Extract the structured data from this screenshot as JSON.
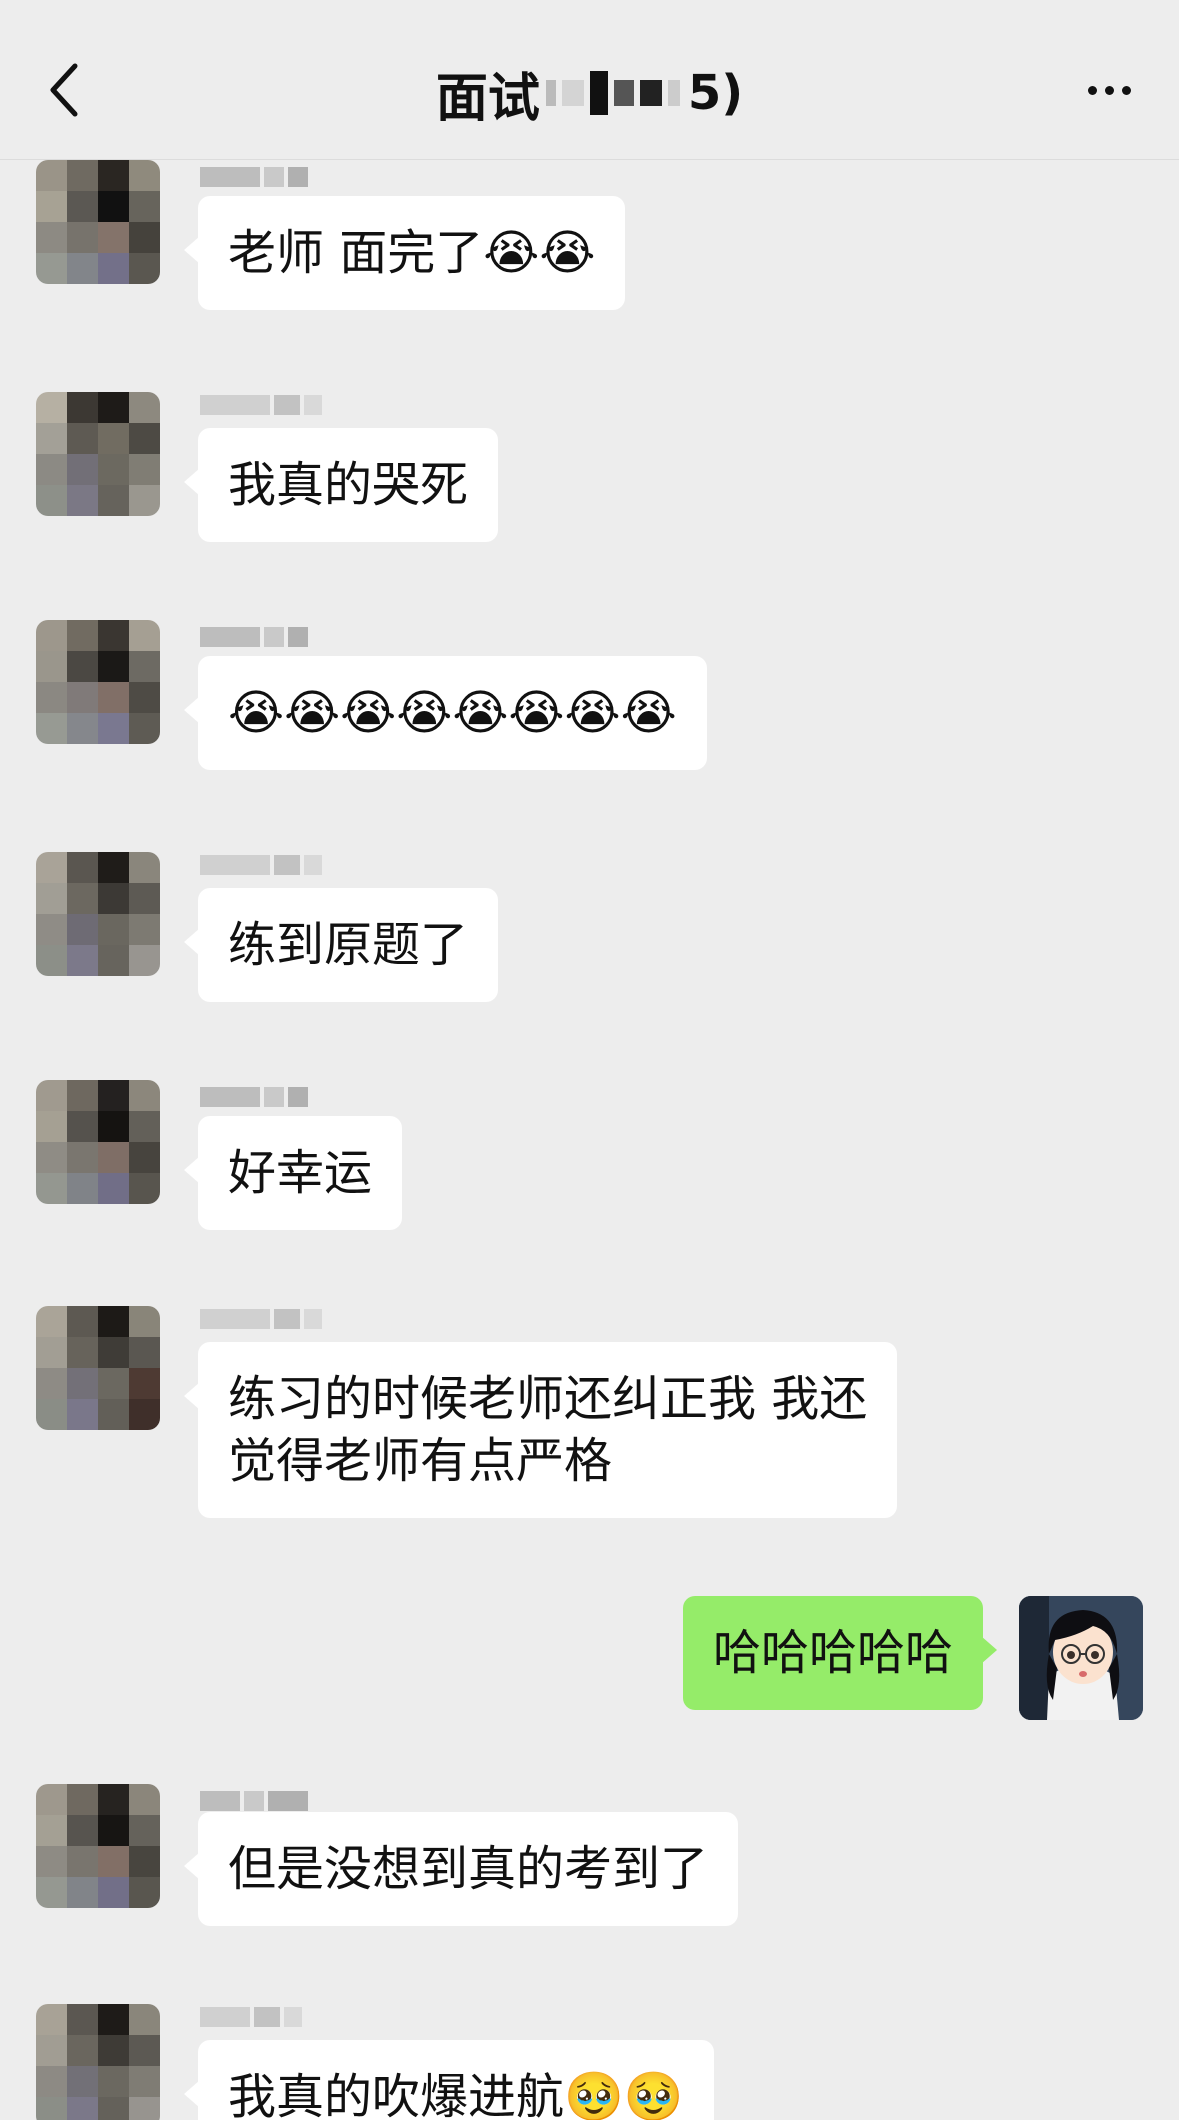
{
  "header": {
    "back_icon": "chevron-left-icon",
    "title": "面试",
    "title_suffix": "5)",
    "more_icon": "more-dots-icon"
  },
  "messages": [
    {
      "side": "left",
      "text": "老师 面完了😭😭"
    },
    {
      "side": "left",
      "text": "我真的哭死"
    },
    {
      "side": "left",
      "text": "😭😭😭😭😭😭😭😭"
    },
    {
      "side": "left",
      "text": "练到原题了"
    },
    {
      "side": "left",
      "text": "好幸运"
    },
    {
      "side": "left",
      "text": "练习的时候老师还纠正我 我还\n觉得老师有点严格"
    },
    {
      "side": "right",
      "text": "哈哈哈哈哈"
    },
    {
      "side": "left",
      "text": "但是没想到真的考到了"
    },
    {
      "side": "left",
      "text": "我真的吹爆进航🥹🥹"
    }
  ],
  "colors": {
    "background": "#ededed",
    "bubble_left": "#ffffff",
    "bubble_right": "#95ec69"
  }
}
